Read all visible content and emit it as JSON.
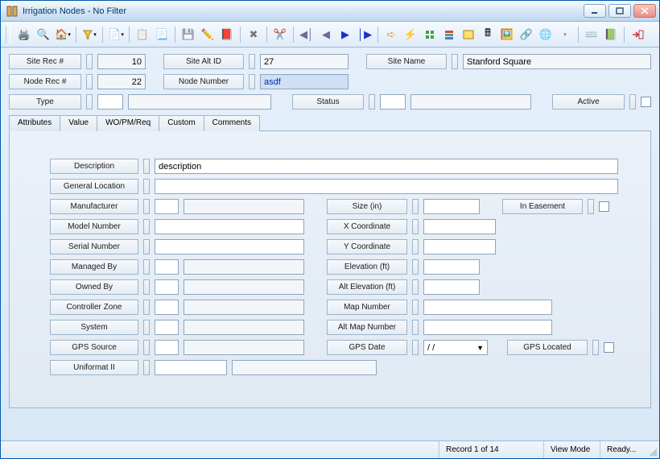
{
  "window": {
    "title": "Irrigation Nodes - No Filter"
  },
  "header": {
    "siteRecLabel": "Site Rec #",
    "siteRecValue": "10",
    "siteAltIdLabel": "Site Alt ID",
    "siteAltIdValue": "27",
    "siteNameLabel": "Site Name",
    "siteNameValue": "Stanford Square",
    "nodeRecLabel": "Node Rec #",
    "nodeRecValue": "22",
    "nodeNumberLabel": "Node Number",
    "nodeNumberValue": "asdf",
    "typeLabel": "Type",
    "typeCode": "",
    "typeDesc": "",
    "statusLabel": "Status",
    "statusCode": "",
    "statusDesc": "",
    "activeLabel": "Active"
  },
  "tabs": {
    "attributes": "Attributes",
    "value": "Value",
    "wopm": "WO/PM/Req",
    "custom": "Custom",
    "comments": "Comments"
  },
  "attr": {
    "descriptionLabel": "Description",
    "descriptionValue": "description",
    "generalLocationLabel": "General Location",
    "generalLocationValue": "",
    "manufacturerLabel": "Manufacturer",
    "manufacturerCode": "",
    "manufacturerDesc": "",
    "sizeLabel": "Size (in)",
    "sizeValue": "",
    "inEasementLabel": "In Easement",
    "modelNumberLabel": "Model Number",
    "modelNumberValue": "",
    "xCoordLabel": "X Coordinate",
    "xCoordValue": "",
    "serialNumberLabel": "Serial Number",
    "serialNumberValue": "",
    "yCoordLabel": "Y Coordinate",
    "yCoordValue": "",
    "managedByLabel": "Managed By",
    "managedByCode": "",
    "managedByDesc": "",
    "elevationLabel": "Elevation (ft)",
    "elevationValue": "",
    "ownedByLabel": "Owned By",
    "ownedByCode": "",
    "ownedByDesc": "",
    "altElevationLabel": "Alt Elevation (ft)",
    "altElevationValue": "",
    "controllerZoneLabel": "Controller Zone",
    "controllerZoneCode": "",
    "controllerZoneDesc": "",
    "mapNumberLabel": "Map Number",
    "mapNumberValue": "",
    "systemLabel": "System",
    "systemCode": "",
    "systemDesc": "",
    "altMapNumberLabel": "Alt Map Number",
    "altMapNumberValue": "",
    "gpsSourceLabel": "GPS Source",
    "gpsSourceCode": "",
    "gpsSourceDesc": "",
    "gpsDateLabel": "GPS Date",
    "gpsDateValue": "  /  /",
    "gpsLocatedLabel": "GPS Located",
    "uniformatLabel": "Uniformat II",
    "uniformatCode": "",
    "uniformatDesc": ""
  },
  "status": {
    "record": "Record 1 of 14",
    "mode": "View Mode",
    "ready": "Ready..."
  }
}
